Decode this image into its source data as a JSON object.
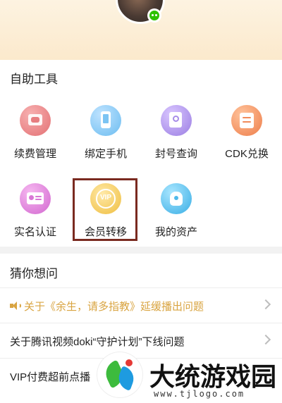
{
  "tools_section": {
    "title": "自助工具",
    "items": [
      {
        "label": "续费管理",
        "icon": "wallet-icon"
      },
      {
        "label": "绑定手机",
        "icon": "phone-icon"
      },
      {
        "label": "封号查询",
        "icon": "search-document-icon"
      },
      {
        "label": "CDK兑换",
        "icon": "exchange-icon"
      },
      {
        "label": "实名认证",
        "icon": "id-card-icon"
      },
      {
        "label": "会员转移",
        "icon": "vip-icon",
        "icon_text": "VIP"
      },
      {
        "label": "我的资产",
        "icon": "asset-bag-icon"
      }
    ]
  },
  "faq_section": {
    "title": "猜你想问",
    "items": [
      {
        "text": "关于《余生，请多指教》延缓播出问题",
        "icon": "speaker-icon",
        "highlight": true
      },
      {
        "text": "关于腾讯视频doki“守护计划”下线问题"
      },
      {
        "text": "VIP付费超前点播"
      }
    ]
  },
  "watermark": {
    "brand": "大统游戏园",
    "url": "www.tjlogo.com"
  },
  "colors": {
    "notice": "#d9a441",
    "highlight_border": "#7a2a20"
  }
}
